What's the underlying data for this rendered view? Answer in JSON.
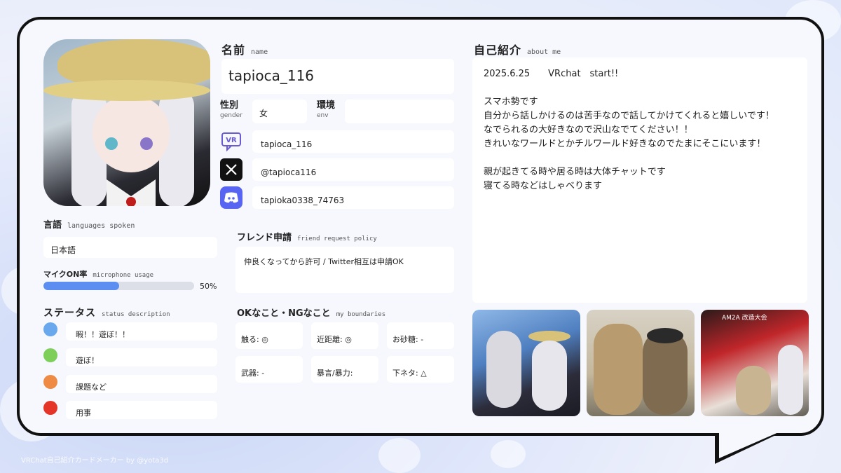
{
  "name_section": {
    "title": "名前",
    "title_en": "name",
    "value": "tapioca_116"
  },
  "gender": {
    "label": "性別",
    "label_en": "gender",
    "value": "女"
  },
  "env": {
    "label": "環境",
    "label_en": "env",
    "value": ""
  },
  "sns": {
    "vrchat": {
      "icon": "vr-icon",
      "value": "tapioca_116"
    },
    "x": {
      "icon": "x-icon",
      "value": "@tapioca116"
    },
    "discord": {
      "icon": "discord-icon",
      "value": "tapioka0338_74763"
    }
  },
  "languages": {
    "title": "言語",
    "title_en": "languages spoken",
    "value": "日本語"
  },
  "mic": {
    "title": "マイクON率",
    "title_en": "microphone usage",
    "percent": 50,
    "percent_label": "50%"
  },
  "status": {
    "title": "ステータス",
    "title_en": "status description",
    "items": [
      {
        "color": "#6aa8ee",
        "label": "暇！！遊ぼ！！"
      },
      {
        "color": "#7ecf5a",
        "label": "遊ぼ！"
      },
      {
        "color": "#ef8a44",
        "label": "課題など"
      },
      {
        "color": "#e53528",
        "label": "用事"
      }
    ]
  },
  "friend": {
    "title": "フレンド申請",
    "title_en": "friend request policy",
    "value": "仲良くなってから許可 / Twitter相互は申請OK"
  },
  "boundaries": {
    "title": "OKなこと・NGなこと",
    "title_en": "my boundaries",
    "items": [
      "触る: ◎",
      "近距離: ◎",
      "お砂糖: -",
      "武器: -",
      "暴言/暴力:",
      "下ネタ: △"
    ]
  },
  "about": {
    "title": "自己紹介",
    "title_en": "about me",
    "line1": "2025.6.25　　VRchat　start!!",
    "body": "スマホ勢です\n自分から話しかけるのは苦手なので話してかけてくれると嬉しいです！\nなでられるの大好きなので沢山なでてください！！\nきれいなワールドとかチルワールド好きなのでたまにそこにいます！\n\n親が起きてる時や居る時は大体チャットです\n寝てる時などはしゃべります"
  },
  "photos": {
    "poster_text": "AM2A 改造大会"
  },
  "footer": "VRChat自己紹介カードメーカー by @yota3d"
}
